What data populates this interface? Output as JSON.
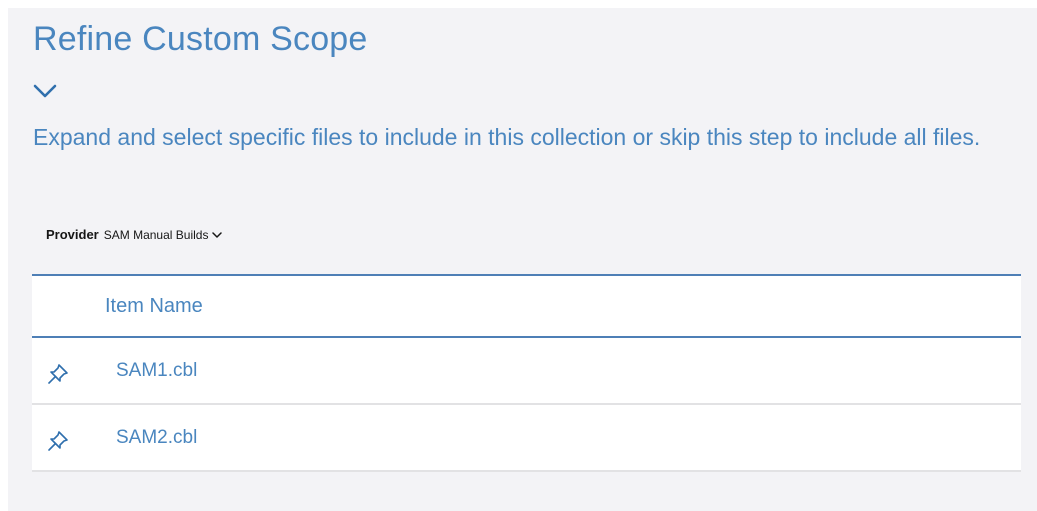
{
  "header": {
    "title": "Refine Custom Scope",
    "toggle_icon": "chevron-down-icon",
    "description": "Expand and select specific files to include in this collection or skip this step to include all files."
  },
  "provider": {
    "label": "Provider",
    "value": "SAM Manual Builds",
    "icon": "chevron-down-icon"
  },
  "table": {
    "columns": [
      "Item Name"
    ],
    "rows": [
      {
        "name": "SAM1.cbl",
        "icon": "pin-icon"
      },
      {
        "name": "SAM2.cbl",
        "icon": "pin-icon"
      }
    ]
  },
  "colors": {
    "accent": "#4a86bf",
    "panel_background": "#f3f3f6",
    "table_rule": "#4e7fb6"
  }
}
